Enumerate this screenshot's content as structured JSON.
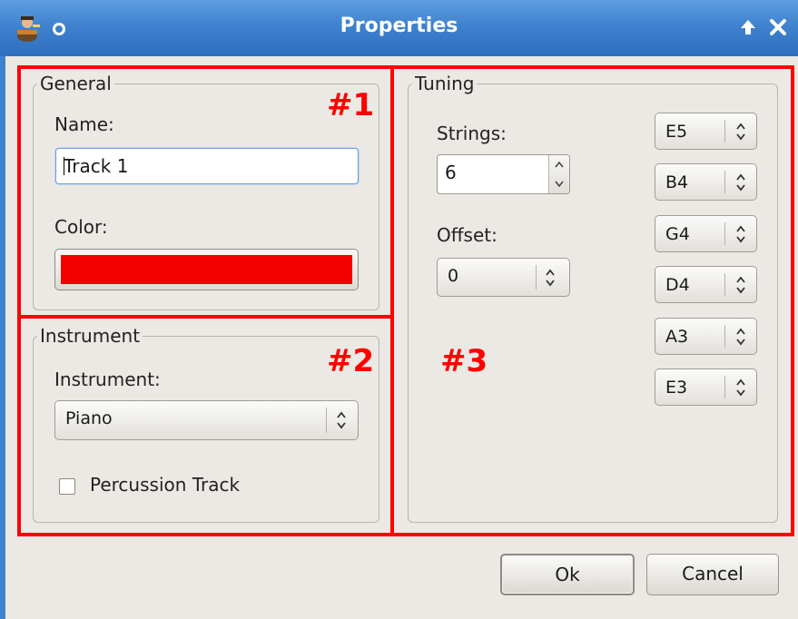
{
  "window": {
    "title": "Properties"
  },
  "general": {
    "legend": "General",
    "name_label": "Name:",
    "name_value": "Track 1",
    "color_label": "Color:",
    "color_value": "#f20000"
  },
  "instrument": {
    "legend": "Instrument",
    "instrument_label": "Instrument:",
    "instrument_value": "Piano",
    "percussion_label": "Percussion Track",
    "percussion_checked": false
  },
  "tuning": {
    "legend": "Tuning",
    "strings_label": "Strings:",
    "strings_value": "6",
    "offset_label": "Offset:",
    "offset_value": "0",
    "string_notes": [
      "E5",
      "B4",
      "G4",
      "D4",
      "A3",
      "E3"
    ]
  },
  "buttons": {
    "ok": "Ok",
    "cancel": "Cancel"
  },
  "annotations": {
    "a1": "#1",
    "a2": "#2",
    "a3": "#3"
  },
  "colors": {
    "title_bar": "#3f82cf",
    "annotation": "#ff0000",
    "window_bg": "#ece9e4"
  },
  "icons": {
    "app": "guitarist-app-icon",
    "pin": "pin-icon",
    "up": "up-arrow-icon",
    "close": "close-icon"
  }
}
